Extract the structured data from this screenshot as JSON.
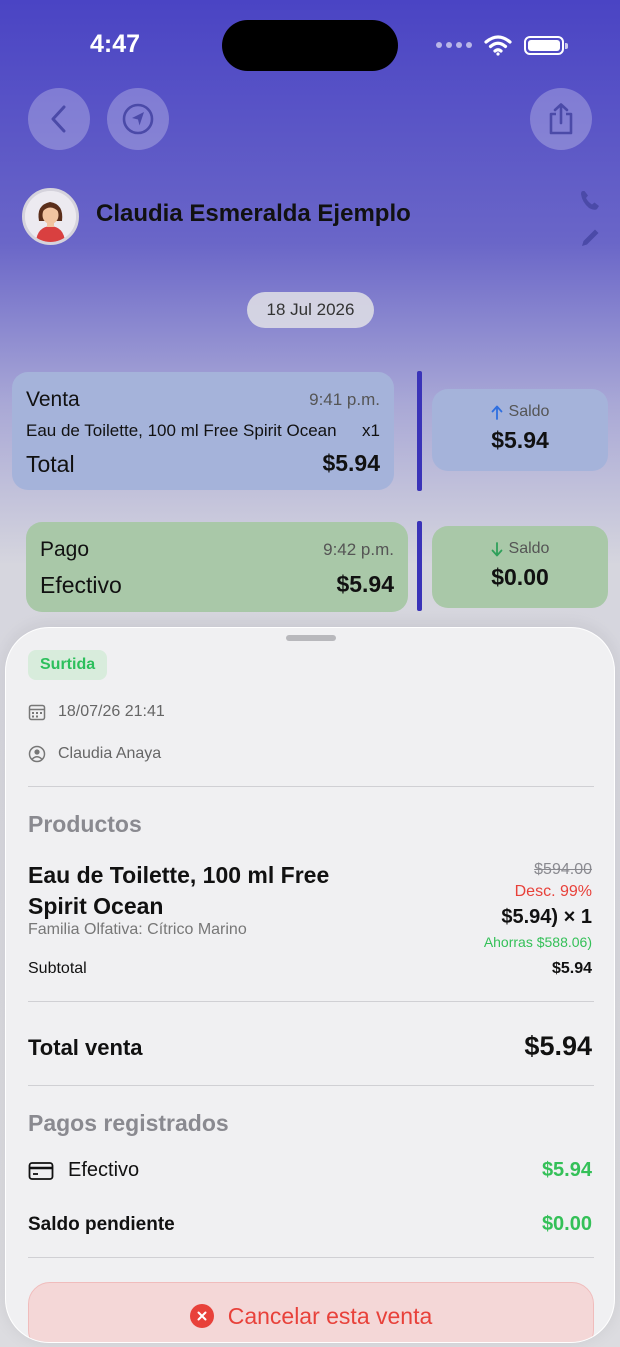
{
  "status_bar": {
    "time": "4:47"
  },
  "contact": {
    "name": "Claudia Esmeralda Ejemplo"
  },
  "date_pill": "18 Jul 2026",
  "timeline": {
    "sale": {
      "title": "Venta",
      "time": "9:41 p.m.",
      "product": "Eau de Toilette, 100 ml Free Spirit Ocean",
      "qty": "x1",
      "total_label": "Total",
      "total_value": "$5.94"
    },
    "sale_balance": {
      "label": "Saldo",
      "value": "$5.94"
    },
    "payment": {
      "title": "Pago",
      "time": "9:42 p.m.",
      "method": "Efectivo",
      "amount": "$5.94"
    },
    "payment_balance": {
      "label": "Saldo",
      "value": "$0.00"
    }
  },
  "sheet": {
    "status_badge": "Surtida",
    "datetime": "18/07/26 21:41",
    "seller": "Claudia Anaya",
    "products_title": "Productos",
    "product": {
      "name": "Eau de Toilette, 100 ml Free Spirit Ocean",
      "attribute": "Familia Olfativa: Cítrico Marino",
      "original_price": "$594.00",
      "discount": "Desc. 99%",
      "unit_price": "$5.94) × 1",
      "savings": "Ahorras $588.06)",
      "subtotal_label": "Subtotal",
      "subtotal_value": "$5.94"
    },
    "total_label": "Total venta",
    "total_value": "$5.94",
    "payments_title": "Pagos registrados",
    "payment_method": "Efectivo",
    "payment_amount": "$5.94",
    "pending_label": "Saldo pendiente",
    "pending_value": "$0.00",
    "cancel_label": "Cancelar esta venta"
  },
  "colors": {
    "accent": "#3a33b8",
    "success": "#34c058",
    "danger": "#e8413a",
    "sale_card": "#a5b3da",
    "payment_card": "#a9c8a8"
  }
}
